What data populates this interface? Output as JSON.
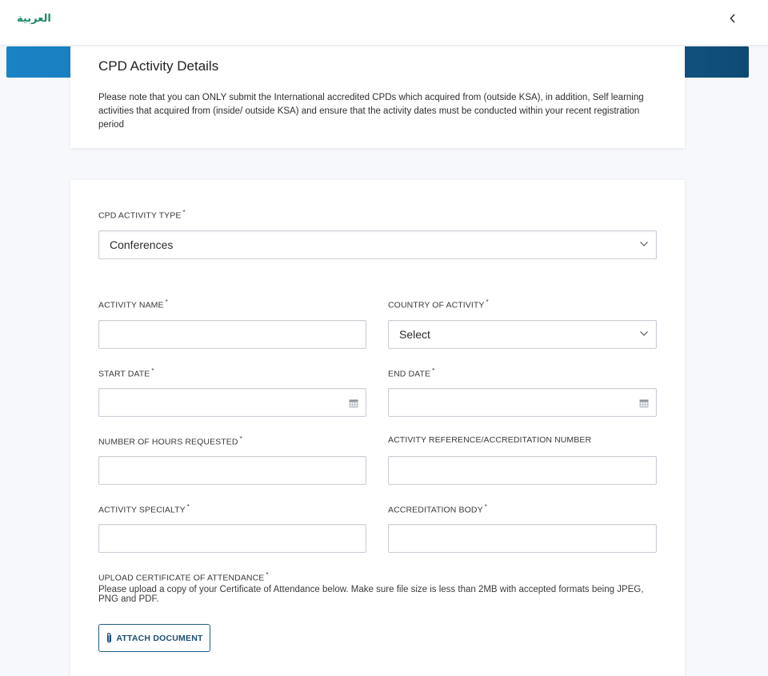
{
  "header": {
    "language_link": "العربية",
    "back_icon": "chevron-left-icon"
  },
  "notice": {
    "title": "CPD Activity Details",
    "text": "Please note that you can ONLY submit the International accredited CPDs which acquired from (outside KSA), in addition, Self learning activities that acquired from (inside/ outside KSA) and ensure that the activity dates must be conducted within your recent registration period"
  },
  "form": {
    "activity_type": {
      "label": "CPD ACTIVITY TYPE",
      "required_mark": "*",
      "value": "Conferences"
    },
    "activity_name": {
      "label": "ACTIVITY NAME",
      "required_mark": "*",
      "value": ""
    },
    "country": {
      "label": "COUNTRY OF ACTIVITY",
      "required_mark": "*",
      "value": "Select"
    },
    "start_date": {
      "label": "START DATE",
      "required_mark": "*",
      "value": ""
    },
    "end_date": {
      "label": "END DATE",
      "required_mark": "*",
      "value": ""
    },
    "hours": {
      "label": "NUMBER OF HOURS REQUESTED",
      "required_mark": "*",
      "value": ""
    },
    "reference": {
      "label": "ACTIVITY REFERENCE/ACCREDITATION NUMBER",
      "value": ""
    },
    "specialty": {
      "label": "ACTIVITY SPECIALTY",
      "required_mark": "*",
      "value": ""
    },
    "accreditation_body": {
      "label": "ACCREDITATION BODY",
      "required_mark": "*",
      "value": ""
    },
    "upload": {
      "label": "UPLOAD CERTIFICATE OF ATTENDANCE",
      "required_mark": "*",
      "description": "Please upload a copy of your Certificate of Attendance below. Make sure file size is less than 2MB with accepted formats being JPEG, PNG and PDF.",
      "button_label": "ATTACH DOCUMENT",
      "button_icon": "paperclip-icon"
    }
  },
  "colors": {
    "band_start": "#1a83c4",
    "band_end": "#0f4a74",
    "arabic_link": "#1a8a6a",
    "button_border": "#1d5d86"
  }
}
